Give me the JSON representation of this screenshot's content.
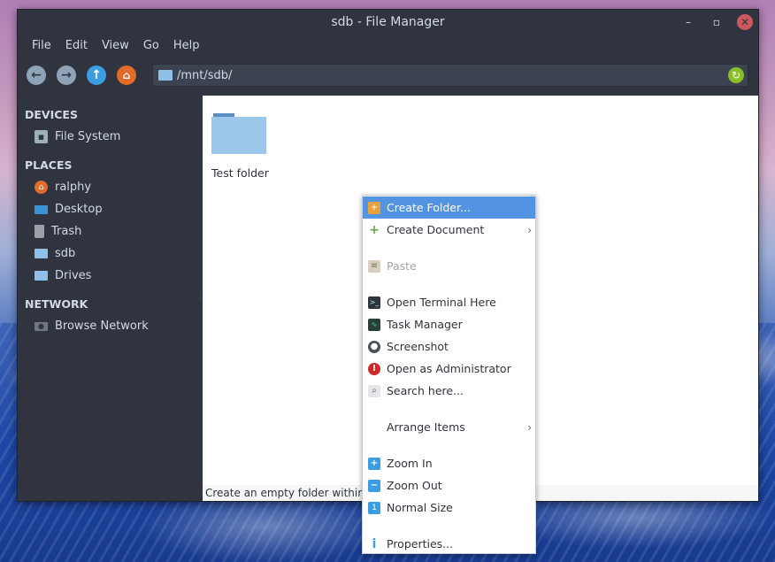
{
  "window": {
    "title": "sdb - File Manager",
    "controls": {
      "minimize": "–",
      "maximize": "▫",
      "close": "✕"
    }
  },
  "menubar": [
    "File",
    "Edit",
    "View",
    "Go",
    "Help"
  ],
  "toolbar": {
    "location": "/mnt/sdb/",
    "icons": [
      "back-icon",
      "forward-icon",
      "up-icon",
      "home-icon",
      "reload-icon"
    ]
  },
  "sidebar": {
    "devices_heading": "DEVICES",
    "devices": [
      {
        "label": "File System",
        "icon": "drive-icon"
      }
    ],
    "places_heading": "PLACES",
    "places": [
      {
        "label": "ralphy",
        "icon": "home-icon"
      },
      {
        "label": "Desktop",
        "icon": "desktop-icon"
      },
      {
        "label": "Trash",
        "icon": "trash-icon"
      },
      {
        "label": "sdb",
        "icon": "folder-icon"
      },
      {
        "label": "Drives",
        "icon": "drives-icon"
      }
    ],
    "network_heading": "NETWORK",
    "network": [
      {
        "label": "Browse Network",
        "icon": "network-icon"
      }
    ]
  },
  "content": {
    "items": [
      {
        "label": "Test folder",
        "icon": "folder-icon"
      }
    ]
  },
  "statusbar": {
    "text": "Create an empty folder within t"
  },
  "context_menu": {
    "items": [
      {
        "label": "Create Folder...",
        "icon": "new-folder-icon",
        "highlighted": true
      },
      {
        "label": "Create Document",
        "icon": "plus-icon",
        "submenu": true
      },
      {
        "label": "Paste",
        "icon": "paste-icon",
        "disabled": true
      },
      {
        "label": "Open Terminal Here",
        "icon": "terminal-icon"
      },
      {
        "label": "Task Manager",
        "icon": "task-manager-icon"
      },
      {
        "label": "Screenshot",
        "icon": "screenshot-icon"
      },
      {
        "label": "Open as Administrator",
        "icon": "admin-icon"
      },
      {
        "label": "Search here...",
        "icon": "search-icon"
      },
      {
        "label": "Arrange Items",
        "submenu": true
      },
      {
        "label": "Zoom In",
        "icon": "zoom-in-icon"
      },
      {
        "label": "Zoom Out",
        "icon": "zoom-out-icon"
      },
      {
        "label": "Normal Size",
        "icon": "normal-size-icon"
      },
      {
        "label": "Properties...",
        "icon": "properties-icon"
      }
    ]
  },
  "colors": {
    "accent": "#5294e2",
    "window_bg": "#2f343f",
    "text_light": "#d3dae3"
  }
}
